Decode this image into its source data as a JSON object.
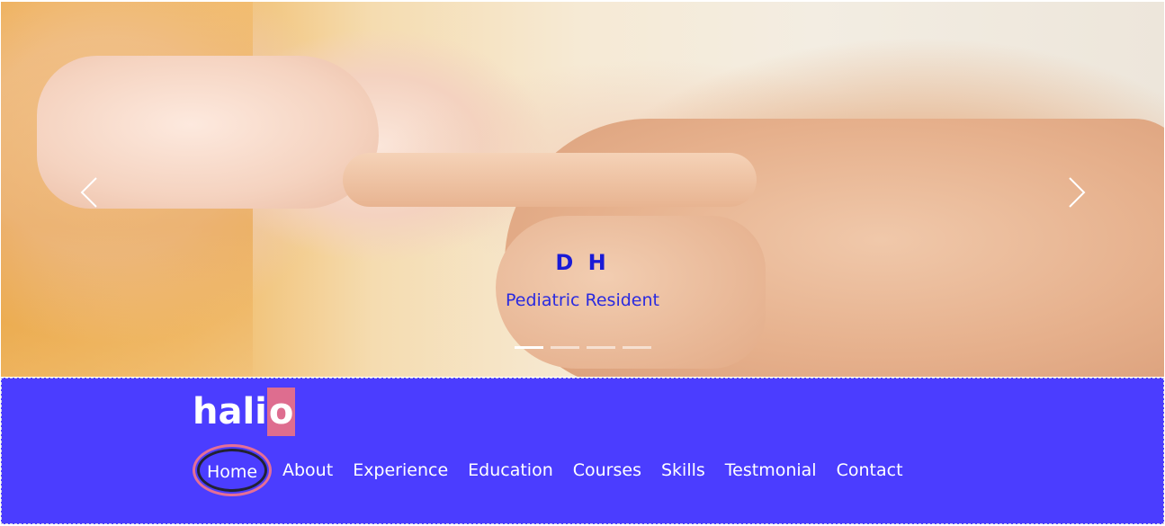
{
  "carousel": {
    "title": "D H",
    "subtitle": "Pediatric Resident",
    "prev_icon": "chevron-left-icon",
    "next_icon": "chevron-right-icon",
    "slide_count": 4,
    "active_slide": 1
  },
  "navbar": {
    "brand_main": "hali",
    "brand_accent": "o",
    "items": [
      {
        "label": "Home",
        "active": true
      },
      {
        "label": "About"
      },
      {
        "label": "Experience"
      },
      {
        "label": "Education"
      },
      {
        "label": "Courses"
      },
      {
        "label": "Skills"
      },
      {
        "label": "Testmonial"
      },
      {
        "label": "Contact"
      }
    ]
  },
  "colors": {
    "navbar_bg": "#4b3dff",
    "brand_accent_bg": "#de6d8f",
    "caption_text": "#1a1ad6",
    "home_ring": "#e56f95"
  }
}
